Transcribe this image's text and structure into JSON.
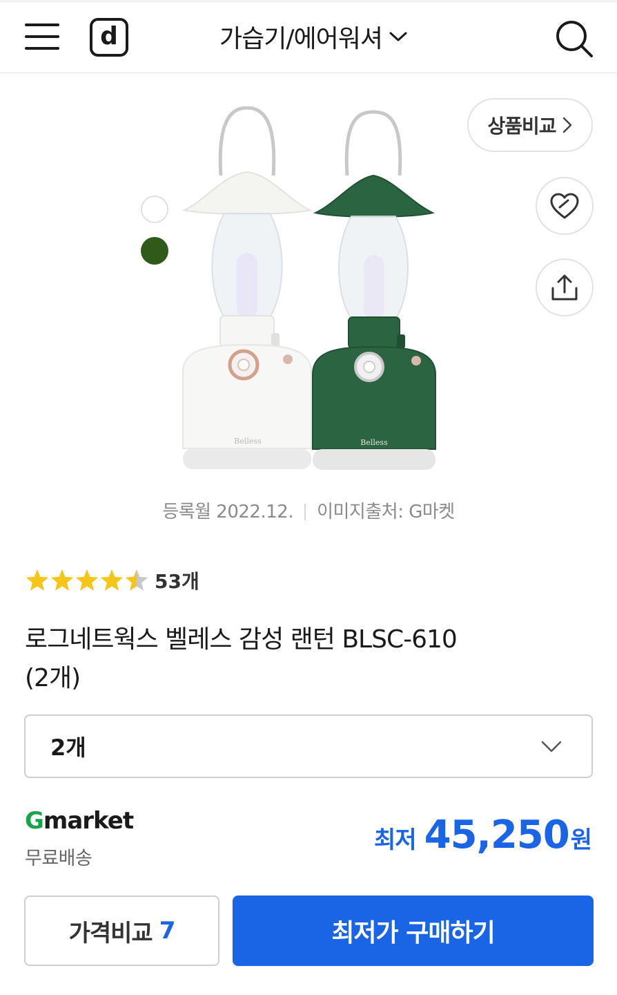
{
  "header": {
    "logo_letter": "d",
    "category": "가습기/에어워셔"
  },
  "image": {
    "swatches": [
      {
        "name": "white",
        "color": "#ffffff"
      },
      {
        "name": "green",
        "color": "#2f5a1a"
      }
    ],
    "compare_label": "상품비교",
    "registered": "등록월 2022.12.",
    "source": "이미지출처: G마켓",
    "brand_mark": "Belless"
  },
  "rating": {
    "value": 4.5,
    "max": 5,
    "count": "53개"
  },
  "product": {
    "title_line1": "로그네트웍스 벨레스 감성 랜턴 BLSC-610",
    "title_line2": "(2개)"
  },
  "option": {
    "selected": "2개"
  },
  "seller": {
    "logo_g": "G",
    "logo_rest": "market",
    "shipping": "무료배송"
  },
  "price": {
    "label": "최저",
    "amount": "45,250",
    "unit": "원"
  },
  "actions": {
    "compare_label": "가격비교",
    "compare_count": "7",
    "buy_label": "최저가 구매하기"
  },
  "colors": {
    "accent": "#1a64e6",
    "gmarket_green": "#1aa34a",
    "star": "#f5c518"
  }
}
